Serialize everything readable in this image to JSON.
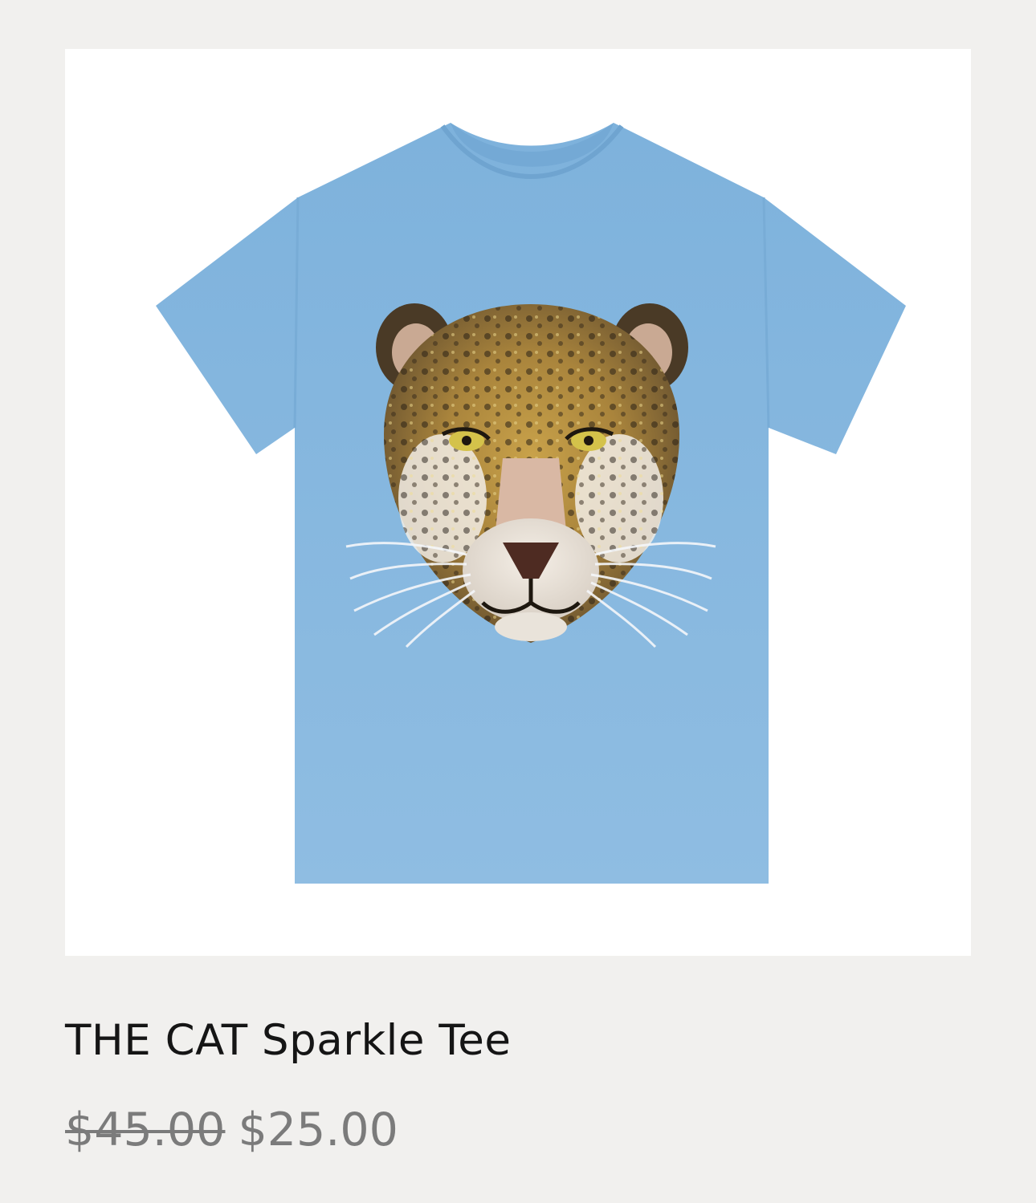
{
  "product": {
    "name": "THE CAT Sparkle Tee",
    "price_original": "$45.00",
    "price_sale": "$25.00",
    "image_subject": "light blue t-shirt with sequined leopard face"
  },
  "colors": {
    "page_background": "#f1f0ee",
    "image_background": "#ffffff",
    "title_text": "#151515",
    "price_text": "#7b7b7b",
    "shirt_blue": "#85b6de"
  }
}
